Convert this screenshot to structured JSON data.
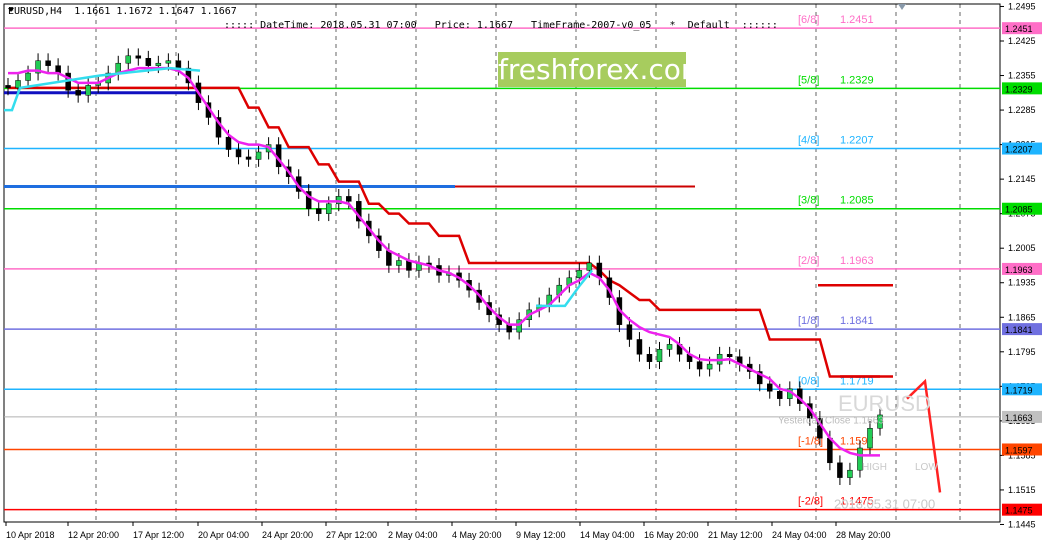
{
  "header": {
    "symbol_info": "EURUSD,H4  1.1661 1.1672 1.1647 1.1667",
    "meta": "::::: DateTime: 2018.05.31 07:00   Price: 1.1667   TimeFrame-2007-v0_05   *  Default  ::::::"
  },
  "watermark": "freshforex.com",
  "chart_data": {
    "type": "candlestick",
    "ylim": [
      1.145,
      1.25
    ],
    "y_ticks": [
      "1.2495",
      "1.2425",
      "1.2355",
      "1.2285",
      "1.2215",
      "1.2145",
      "1.2075",
      "1.2005",
      "1.1935",
      "1.1865",
      "1.1795",
      "1.1725",
      "1.1655",
      "1.1585",
      "1.1515",
      "1.1445"
    ],
    "x_ticks": [
      "10 Apr 2018",
      "12 Apr 20:00",
      "17 Apr 12:00",
      "20 Apr 04:00",
      "24 Apr 20:00",
      "27 Apr 12:00",
      "2 May 04:00",
      "4 May 20:00",
      "9 May 12:00",
      "14 May 04:00",
      "16 May 20:00",
      "21 May 12:00",
      "24 May 04:00",
      "28 May 20:00"
    ],
    "murrey_levels": [
      {
        "label": "[6/8]",
        "value": "1.2451",
        "tag": "1.2451",
        "price": 1.2451,
        "color": "#ff6ec7"
      },
      {
        "label": "[5/8]",
        "value": "1.2329",
        "tag": "1.2329",
        "price": 1.2329,
        "color": "#00dd00"
      },
      {
        "label": "[4/8]",
        "value": "1.2207",
        "tag": "1.2207",
        "price": 1.2207,
        "color": "#1eb4ff"
      },
      {
        "label": "[3/8]",
        "value": "1.2085",
        "tag": "1.2085",
        "price": 1.2085,
        "color": "#00dd00"
      },
      {
        "label": "[2/8]",
        "value": "1.1963",
        "tag": "1.1963",
        "price": 1.1963,
        "color": "#ff6ec7"
      },
      {
        "label": "[1/8]",
        "value": "1.1841",
        "tag": "1.1841",
        "price": 1.1841,
        "color": "#7070e0"
      },
      {
        "label": "[0/8]",
        "value": "1.1719",
        "tag": "1.1719",
        "price": 1.1719,
        "color": "#1eb4ff"
      },
      {
        "label": "[-1/8]",
        "value": "1.1597",
        "tag": "1.1597",
        "price": 1.1597,
        "color": "#ff4500"
      },
      {
        "label": "[-2/8]",
        "value": "1.1475",
        "tag": "1.1475",
        "price": 1.1475,
        "color": "#ff0000"
      }
    ],
    "current_price": {
      "tag": "1.1663",
      "price": 1.1663
    },
    "overlay_text": {
      "symbol": "EURUSD",
      "yesterday": "Yesterday Close 1.1663",
      "high": "HIGH",
      "low": "LOW",
      "datetime": "2018.05.31 07:00"
    },
    "closes": [
      1.233,
      1.2345,
      1.236,
      1.2385,
      1.2375,
      1.236,
      1.2325,
      1.2315,
      1.2335,
      1.234,
      1.236,
      1.238,
      1.2395,
      1.239,
      1.2375,
      1.238,
      1.2385,
      1.237,
      1.234,
      1.23,
      1.227,
      1.223,
      1.2205,
      1.219,
      1.2185,
      1.22,
      1.2215,
      1.217,
      1.215,
      1.212,
      1.2085,
      1.2075,
      1.2095,
      1.211,
      1.21,
      1.206,
      1.203,
      1.2,
      1.197,
      1.198,
      1.196,
      1.1975,
      1.197,
      1.195,
      1.1955,
      1.194,
      1.192,
      1.1895,
      1.187,
      1.185,
      1.1835,
      1.186,
      1.188,
      1.189,
      1.191,
      1.193,
      1.1945,
      1.196,
      1.1975,
      1.1945,
      1.1905,
      1.185,
      1.182,
      1.179,
      1.1775,
      1.18,
      1.181,
      1.179,
      1.1775,
      1.176,
      1.177,
      1.179,
      1.1785,
      1.177,
      1.1755,
      1.173,
      1.1715,
      1.17,
      1.172,
      1.169,
      1.166,
      1.162,
      1.157,
      1.154,
      1.1555,
      1.16,
      1.164,
      1.1667
    ],
    "ma_magenta": [
      1.236,
      1.236,
      1.2365,
      1.2365,
      1.236,
      1.236,
      1.235,
      1.234,
      1.234,
      1.234,
      1.235,
      1.236,
      1.2365,
      1.237,
      1.237,
      1.237,
      1.237,
      1.2365,
      1.235,
      1.232,
      1.229,
      1.226,
      1.2235,
      1.222,
      1.2215,
      1.2215,
      1.221,
      1.2185,
      1.216,
      1.213,
      1.211,
      1.21,
      1.21,
      1.21,
      1.2095,
      1.207,
      1.2045,
      1.202,
      1.2,
      1.199,
      1.198,
      1.1975,
      1.197,
      1.196,
      1.1955,
      1.1945,
      1.193,
      1.191,
      1.1885,
      1.1865,
      1.185,
      1.185,
      1.187,
      1.188,
      1.189,
      1.191,
      1.193,
      1.194,
      1.1955,
      1.1945,
      1.192,
      1.188,
      1.186,
      1.1845,
      1.1835,
      1.183,
      1.1825,
      1.181,
      1.179,
      1.178,
      1.1778,
      1.1778,
      1.178,
      1.177,
      1.176,
      1.175,
      1.174,
      1.172,
      1.1715,
      1.17,
      1.168,
      1.165,
      1.162,
      1.16,
      1.159,
      1.1585,
      1.1585,
      1.1585
    ],
    "trail_red": [
      1.233,
      1.233,
      1.233,
      1.233,
      1.233,
      1.233,
      1.233,
      1.233,
      1.233,
      1.233,
      1.233,
      1.233,
      1.233,
      1.233,
      1.233,
      1.233,
      1.233,
      1.233,
      1.233,
      1.233,
      1.233,
      1.233,
      1.233,
      1.233,
      1.229,
      1.229,
      1.225,
      1.225,
      1.221,
      1.221,
      1.221,
      1.2175,
      1.2175,
      1.214,
      1.214,
      1.214,
      1.2095,
      1.2095,
      1.2075,
      1.2075,
      1.2055,
      1.2055,
      1.2055,
      1.203,
      1.203,
      1.203,
      1.1975,
      1.1975,
      1.1975,
      1.1975,
      1.1975,
      1.1975,
      1.1975,
      1.1975,
      1.1975,
      1.1975,
      1.1975,
      1.1975,
      1.1975,
      1.196,
      1.194,
      1.193,
      1.1915,
      1.19,
      1.19,
      1.188,
      1.188,
      1.188,
      1.188,
      1.188,
      1.188,
      1.188,
      1.188,
      1.188,
      1.188,
      1.188,
      1.182,
      1.182,
      1.182,
      1.182,
      1.182,
      1.182,
      1.1745,
      1.1745,
      1.1745,
      1.1745,
      1.1745,
      1.1745
    ]
  }
}
